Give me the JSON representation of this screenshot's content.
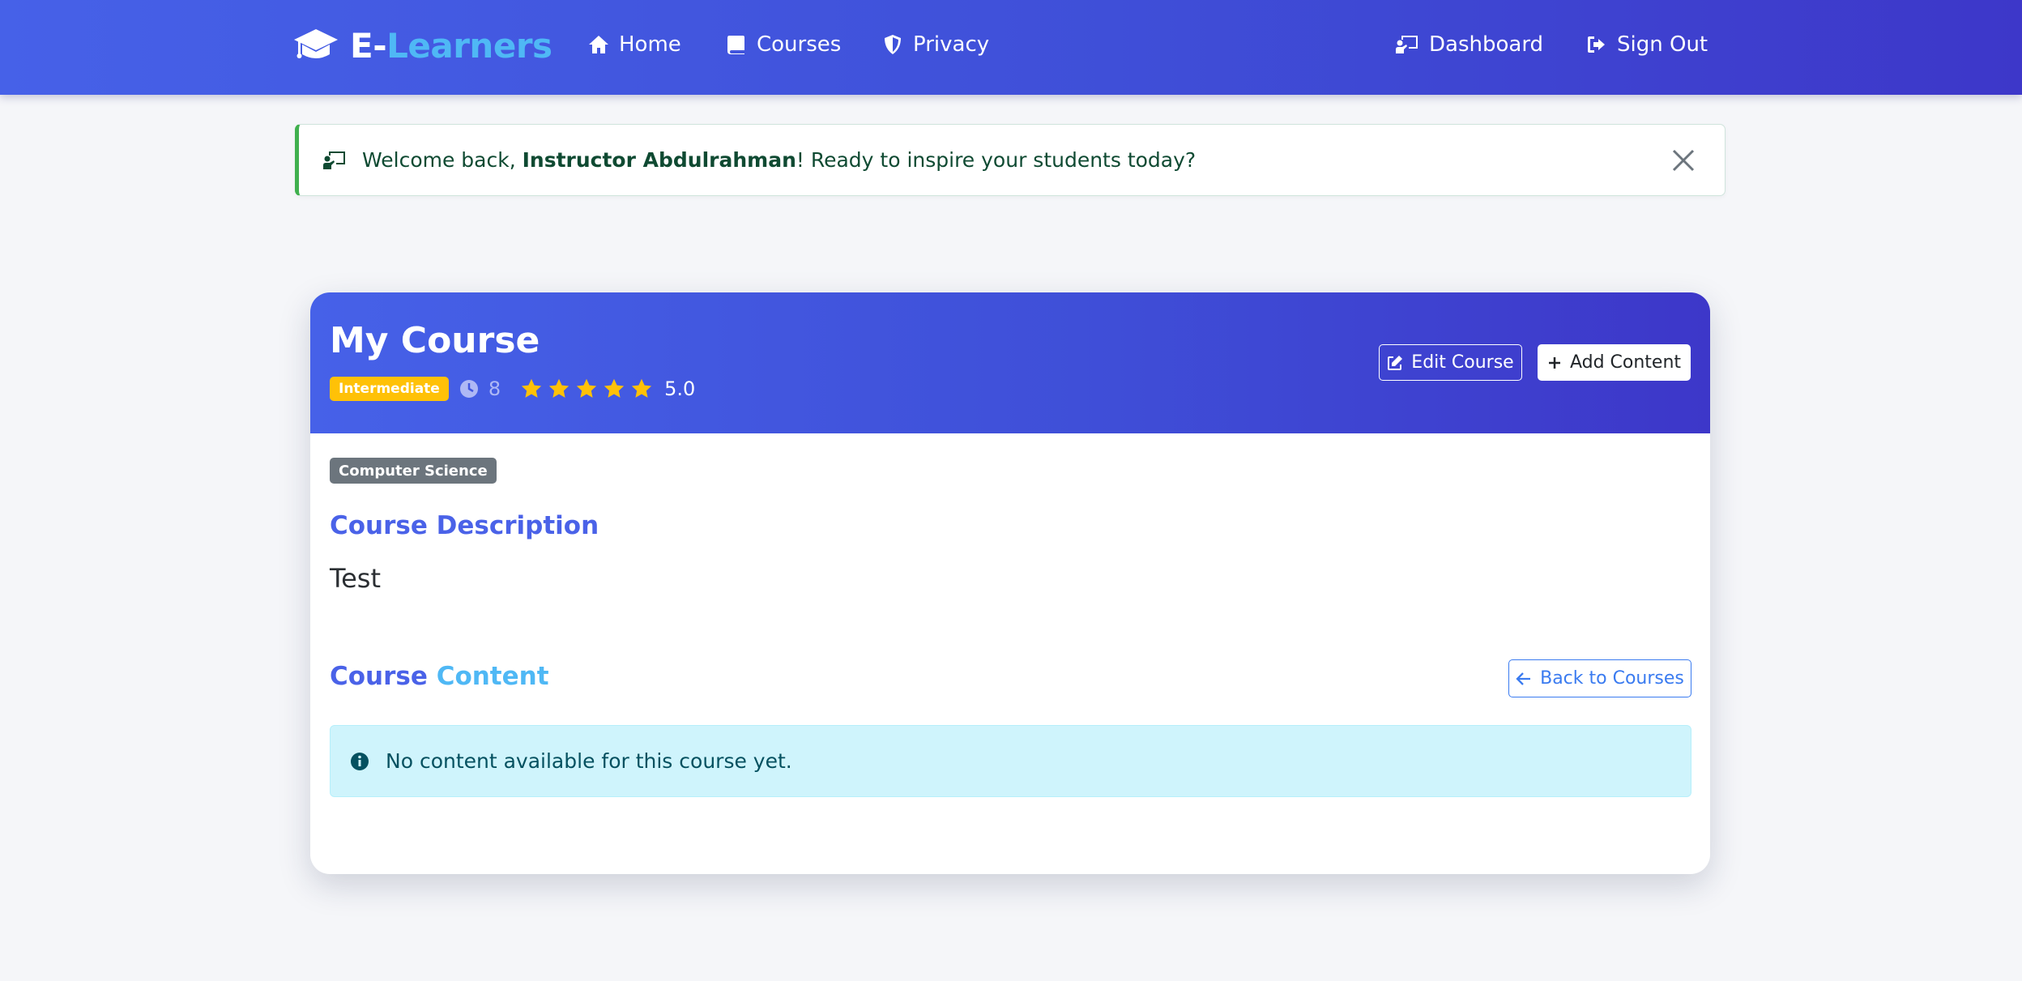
{
  "navbar": {
    "brand_prefix": "E-",
    "brand_suffix": "Learners",
    "items": [
      {
        "label": "Home",
        "icon": "home-icon"
      },
      {
        "label": "Courses",
        "icon": "book-icon"
      },
      {
        "label": "Privacy",
        "icon": "shield-icon"
      },
      {
        "label": "Dashboard",
        "icon": "chalkboard-teacher-icon"
      },
      {
        "label": "Sign Out",
        "icon": "sign-out-icon"
      }
    ]
  },
  "alert": {
    "prefix": "Welcome back, ",
    "name": "Instructor Abdulrahman",
    "suffix": "! Ready to inspire your students today?"
  },
  "course": {
    "title": "My Course",
    "level": "Intermediate",
    "duration": "8",
    "rating": 5.0,
    "rating_text": "5.0",
    "edit_label": "Edit Course",
    "add_label": "Add Content",
    "category": "Computer Science",
    "description_heading": "Course Description",
    "description": "Test",
    "content_heading_1": "Course",
    "content_heading_2": "Content",
    "back_label": "Back to Courses",
    "empty_message": "No content available for this course yet."
  },
  "colors": {
    "primary": "#4661e8",
    "accent": "#4fb8f5",
    "success": "#3fb04e",
    "warning": "#ffc107",
    "info_bg": "#cff4fc"
  }
}
